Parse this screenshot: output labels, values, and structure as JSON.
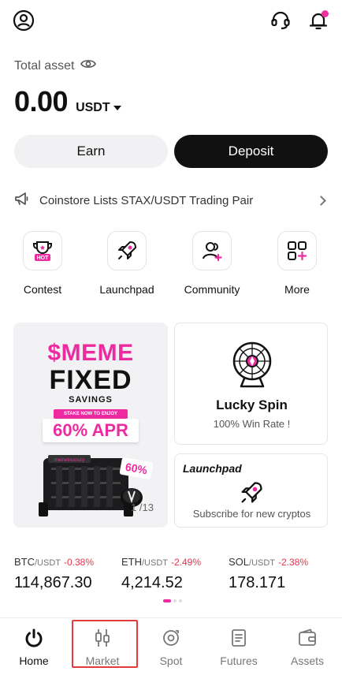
{
  "header": {
    "profile_icon": "profile-icon",
    "support_icon": "headset-icon",
    "notification_icon": "bell-icon"
  },
  "asset": {
    "label": "Total asset",
    "value": "0.00",
    "unit": "USDT"
  },
  "actions": {
    "earn_label": "Earn",
    "deposit_label": "Deposit"
  },
  "announcement": {
    "text": "Coinstore Lists STAX/USDT Trading Pair"
  },
  "shortcuts": [
    {
      "label": "Contest",
      "icon": "trophy-icon",
      "badge": "HOT"
    },
    {
      "label": "Launchpad",
      "icon": "rocket-icon"
    },
    {
      "label": "Community",
      "icon": "community-icon"
    },
    {
      "label": "More",
      "icon": "grid-plus-icon"
    }
  ],
  "promo": {
    "line1": "$MEME",
    "line2": "FIXED",
    "line3": "SAVINGS",
    "stake_text": "STAKE NOW TO ENJOY",
    "apr": "60% APR",
    "art_brand": "memetreasury",
    "art_percent": "60%",
    "page_indicator": "1 /13"
  },
  "lucky_spin": {
    "title": "Lucky Spin",
    "subtitle": "100% Win Rate !"
  },
  "launchpad_card": {
    "title": "Launchpad",
    "subtitle": "Subscribe for new cryptos"
  },
  "tickers": [
    {
      "base": "BTC",
      "quote": "/USDT",
      "change": "-0.38%",
      "price": "114,867.30"
    },
    {
      "base": "ETH",
      "quote": "/USDT",
      "change": "-2.49%",
      "price": "4,214.52"
    },
    {
      "base": "SOL",
      "quote": "/USDT",
      "change": "-2.38%",
      "price": "178.171"
    }
  ],
  "nav": [
    {
      "label": "Home",
      "icon": "home-power-icon"
    },
    {
      "label": "Market",
      "icon": "candlestick-icon"
    },
    {
      "label": "Spot",
      "icon": "spot-icon"
    },
    {
      "label": "Futures",
      "icon": "futures-icon"
    },
    {
      "label": "Assets",
      "icon": "wallet-icon"
    }
  ],
  "colors": {
    "accent": "#ee2aa0",
    "negative": "#e5334d",
    "highlight_box": "#e63b3b"
  }
}
